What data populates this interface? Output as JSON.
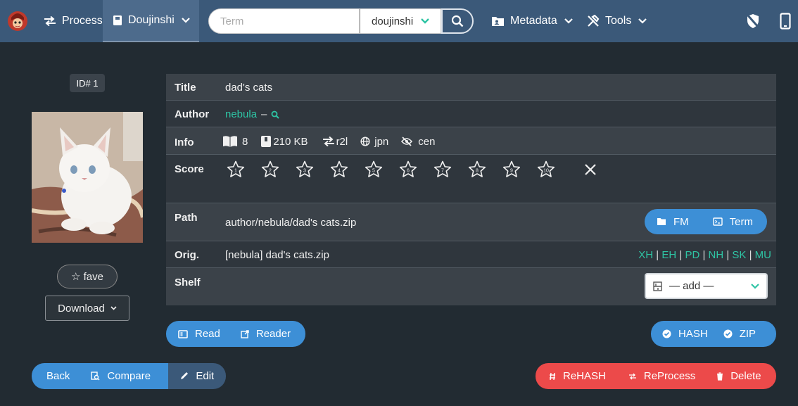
{
  "nav": {
    "process": "Process",
    "category": "Doujinshi",
    "search_placeholder": "Term",
    "search_scope": "doujinshi",
    "metadata": "Metadata",
    "tools": "Tools"
  },
  "book": {
    "id_label": "ID# 1",
    "fave_label": "☆ fave",
    "download_label": "Download"
  },
  "rows": {
    "title": {
      "key": "Title",
      "value": "dad's cats"
    },
    "author": {
      "key": "Author",
      "value": "nebula",
      "sep": "–"
    },
    "info": {
      "key": "Info",
      "pages": "8",
      "size": "210 KB",
      "direction": "r2l",
      "language": "jpn",
      "censorship": "cen"
    },
    "score": {
      "key": "Score",
      "stars": [
        "1",
        "2",
        "3",
        "4",
        "5",
        "6",
        "7",
        "8",
        "9",
        "10"
      ]
    },
    "path": {
      "key": "Path",
      "value": "author/nebula/dad's cats.zip",
      "fm": "FM",
      "term": "Term"
    },
    "orig": {
      "key": "Orig.",
      "value": "[nebula] dad's cats.zip",
      "links": [
        "XH",
        "EH",
        "PD",
        "NH",
        "SK",
        "MU"
      ]
    },
    "shelf": {
      "key": "Shelf",
      "select": "— add —"
    }
  },
  "actions": {
    "read": "Read",
    "reader": "Reader",
    "hash": "HASH",
    "zip": "ZIP",
    "back": "Back",
    "compare": "Compare",
    "edit": "Edit",
    "rehash": "ReHASH",
    "reprocess": "ReProcess",
    "delete": "Delete"
  },
  "colors": {
    "navbar": "#3b5979",
    "accent": "#2ec4a4",
    "primary": "#3d8fd6",
    "danger": "#ec4a4a",
    "background": "#222b32"
  }
}
